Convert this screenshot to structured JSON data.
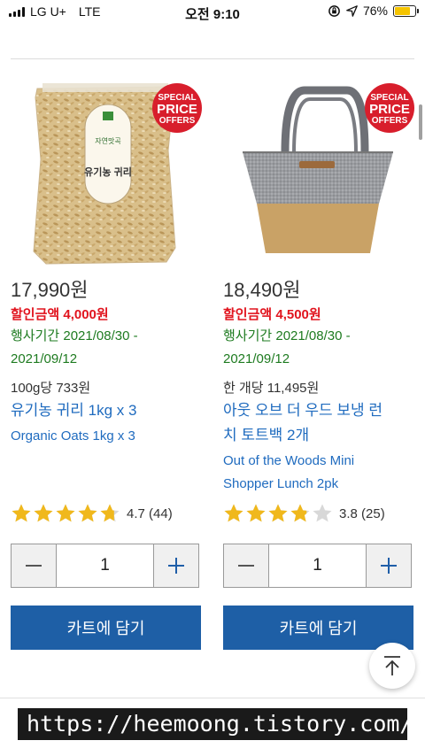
{
  "status_bar": {
    "carrier": "LG U+",
    "network": "LTE",
    "time": "오전 9:10",
    "battery": "76%",
    "battery_level": 0.76
  },
  "products": [
    {
      "badge": {
        "line1": "SPECIAL",
        "line2": "PRICE",
        "line3": "OFFERS"
      },
      "package_label": {
        "top": "자연맛곡",
        "name": "유기농 귀리"
      },
      "price": "17,990원",
      "discount": "할인금액 4,000원",
      "period_line1": "행사기간 2021/08/30 -",
      "period_line2": "2021/09/12",
      "unit_price": "100g당 733원",
      "name_ko": "유기농 귀리 1kg x 3",
      "name_en": "Organic Oats 1kg x 3",
      "rating_value": 4.7,
      "rating_text": "4.7 (44)",
      "quantity": "1",
      "cart_label": "카트에 담기"
    },
    {
      "badge": {
        "line1": "SPECIAL",
        "line2": "PRICE",
        "line3": "OFFERS"
      },
      "price": "18,490원",
      "discount": "할인금액 4,500원",
      "period_line1": "행사기간 2021/08/30 -",
      "period_line2": "2021/09/12",
      "unit_price": "한 개당 11,495원",
      "name_ko_line1": "아웃 오브 더 우드 보냉 런",
      "name_ko_line2": "치 토트백 2개",
      "name_en_line1": "Out of the Woods Mini",
      "name_en_line2": "Shopper Lunch 2pk",
      "rating_value": 3.8,
      "rating_text": "3.8 (25)",
      "quantity": "1",
      "cart_label": "카트에 담기"
    }
  ],
  "watermark": "https://heemoong.tistory.com/",
  "colors": {
    "primary_blue": "#1e5fa6",
    "link_blue": "#1f6bbf",
    "discount_red": "#e1141e",
    "period_green": "#1e7b20",
    "badge_red": "#d81e2c",
    "star_gold": "#f0b81c"
  },
  "icons": {
    "minus": "minus-icon",
    "plus": "plus-icon",
    "scroll_top": "arrow-up-icon",
    "star": "star-icon"
  }
}
